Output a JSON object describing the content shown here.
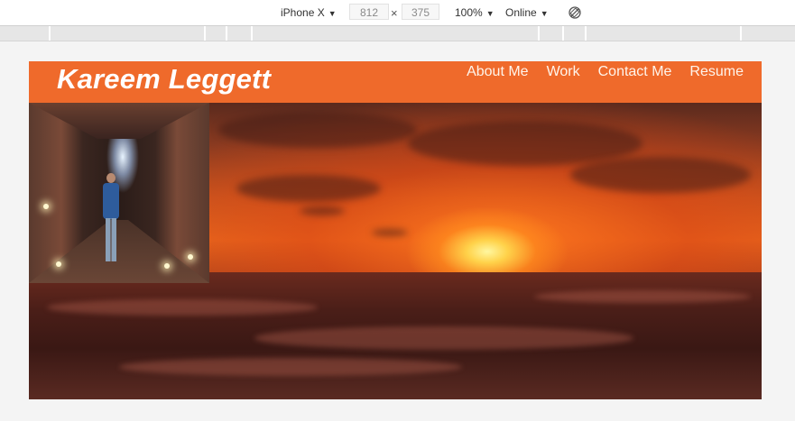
{
  "devtools": {
    "device": "iPhone X",
    "width": "812",
    "times": "×",
    "height": "375",
    "zoom": "100%",
    "network": "Online",
    "caret": "▼"
  },
  "site": {
    "brand": "Kareem Leggett",
    "nav": [
      {
        "label": "About Me"
      },
      {
        "label": "Work"
      },
      {
        "label": "Contact Me"
      },
      {
        "label": "Resume"
      }
    ],
    "colors": {
      "header_bg": "#ef6a2b",
      "text": "#ffffff"
    }
  },
  "icons": {
    "rotate": "rotate-icon"
  }
}
